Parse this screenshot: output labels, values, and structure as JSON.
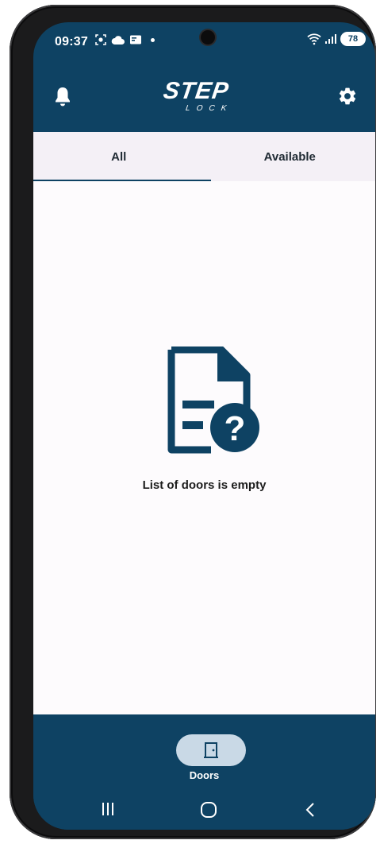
{
  "status_bar": {
    "time": "09:37",
    "battery": "78"
  },
  "app_bar": {
    "logo_main": "STEP",
    "logo_sub": "LOCK"
  },
  "tabs": [
    {
      "label": "All",
      "selected": true
    },
    {
      "label": "Available",
      "selected": false
    }
  ],
  "empty_state": {
    "message": "List of doors is empty",
    "icon": "document-question-icon"
  },
  "bottom_nav": {
    "items": [
      {
        "label": "Doors",
        "icon": "door-icon",
        "selected": true
      }
    ]
  },
  "colors": {
    "primary": "#0e4263",
    "tab_background": "#f4f0f6",
    "content_background": "#fdfbfd",
    "nav_pill": "#c9d9e6"
  }
}
